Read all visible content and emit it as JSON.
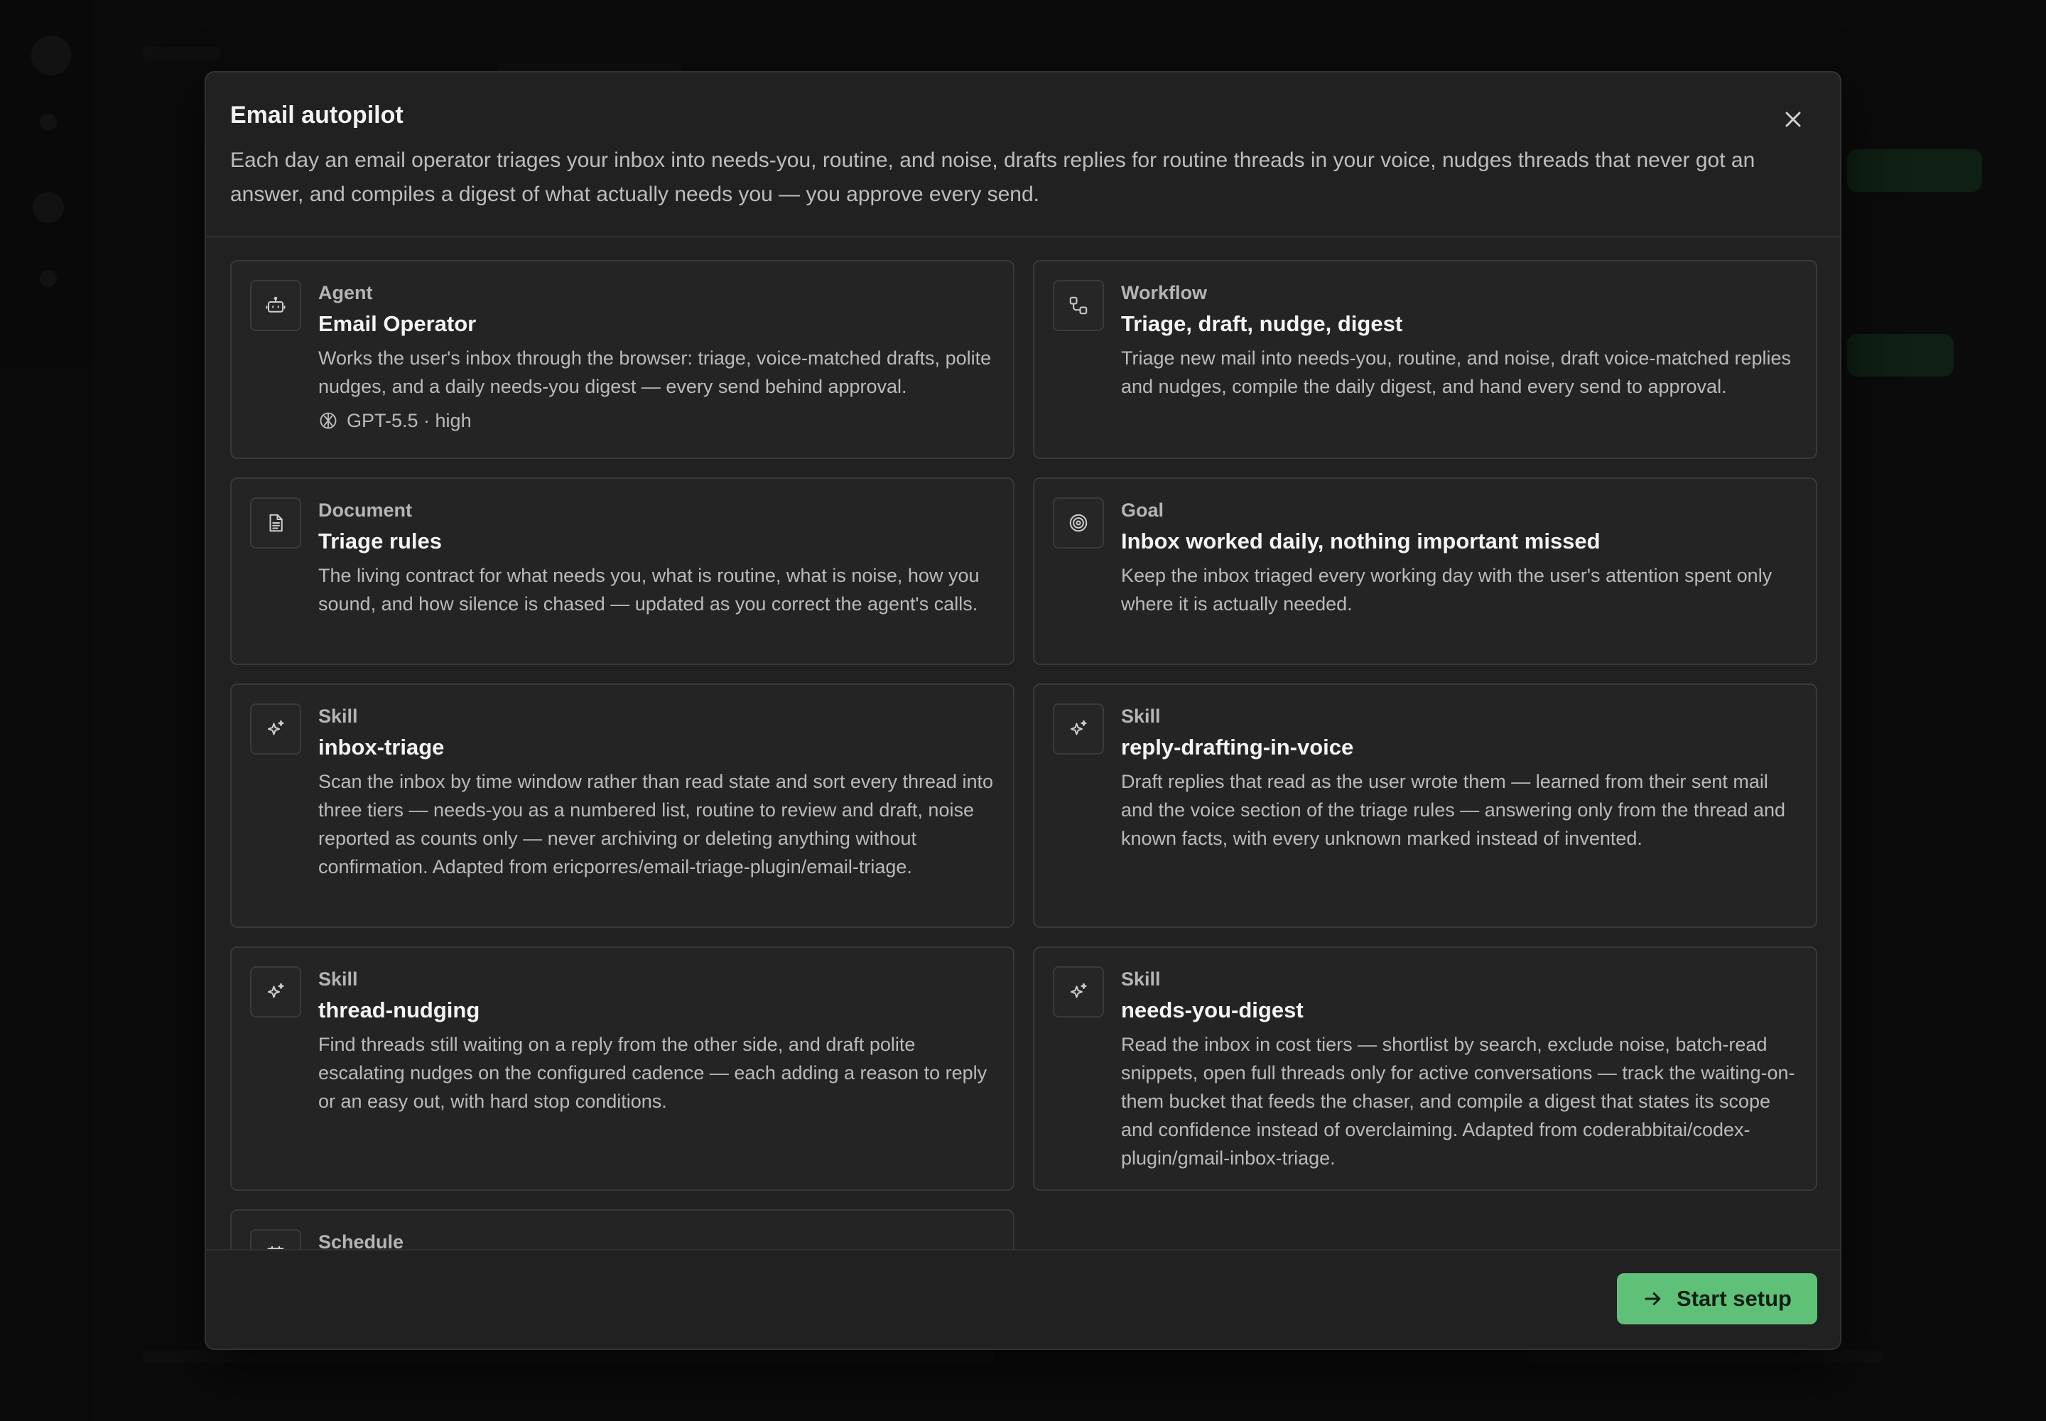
{
  "modal": {
    "title": "Email autopilot",
    "description": "Each day an email operator triages your inbox into needs-you, routine, and noise, drafts replies for routine threads in your voice, nudges threads that never got an answer, and compiles a digest of what actually needs you — you approve every send."
  },
  "cards": [
    {
      "icon": "robot-icon",
      "kind": "Agent",
      "name": "Email Operator",
      "description": "Works the user's inbox through the browser: triage, voice-matched drafts, polite nudges, and a daily needs-you digest — every send behind approval.",
      "meta": "GPT-5.5 · high"
    },
    {
      "icon": "workflow-icon",
      "kind": "Workflow",
      "name": "Triage, draft, nudge, digest",
      "description": "Triage new mail into needs-you, routine, and noise, draft voice-matched replies and nudges, compile the daily digest, and hand every send to approval."
    },
    {
      "icon": "document-icon",
      "kind": "Document",
      "name": "Triage rules",
      "description": "The living contract for what needs you, what is routine, what is noise, how you sound, and how silence is chased — updated as you correct the agent's calls."
    },
    {
      "icon": "target-icon",
      "kind": "Goal",
      "name": "Inbox worked daily, nothing important missed",
      "description": "Keep the inbox triaged every working day with the user's attention spent only where it is actually needed."
    },
    {
      "icon": "sparkle-icon",
      "kind": "Skill",
      "name": "inbox-triage",
      "description": "Scan the inbox by time window rather than read state and sort every thread into three tiers — needs-you as a numbered list, routine to review and draft, noise reported as counts only — never archiving or deleting anything without confirmation. Adapted from ericporres/email-triage-plugin/email-triage."
    },
    {
      "icon": "sparkle-icon",
      "kind": "Skill",
      "name": "reply-drafting-in-voice",
      "description": "Draft replies that read as the user wrote them — learned from their sent mail and the voice section of the triage rules — answering only from the thread and known facts, with every unknown marked instead of invented."
    },
    {
      "icon": "sparkle-icon",
      "kind": "Skill",
      "name": "thread-nudging",
      "description": "Find threads still waiting on a reply from the other side, and draft polite escalating nudges on the configured cadence — each adding a reason to reply or an easy out, with hard stop conditions."
    },
    {
      "icon": "sparkle-icon",
      "kind": "Skill",
      "name": "needs-you-digest",
      "description": "Read the inbox in cost tiers — shortlist by search, exclude noise, batch-read snippets, open full threads only for active conversations — track the waiting-on-them bucket that feeds the chaser, and compile a digest that states its scope and confidence instead of overclaiming. Adapted from coderabbitai/codex-plugin/gmail-inbox-triage."
    },
    {
      "icon": "calendar-icon",
      "kind": "Schedule",
      "name": "",
      "description": ""
    }
  ],
  "footer": {
    "start_label": "Start setup"
  },
  "colors": {
    "accent": "#5fc178",
    "modal_bg": "#212121",
    "card_border": "#393939"
  }
}
